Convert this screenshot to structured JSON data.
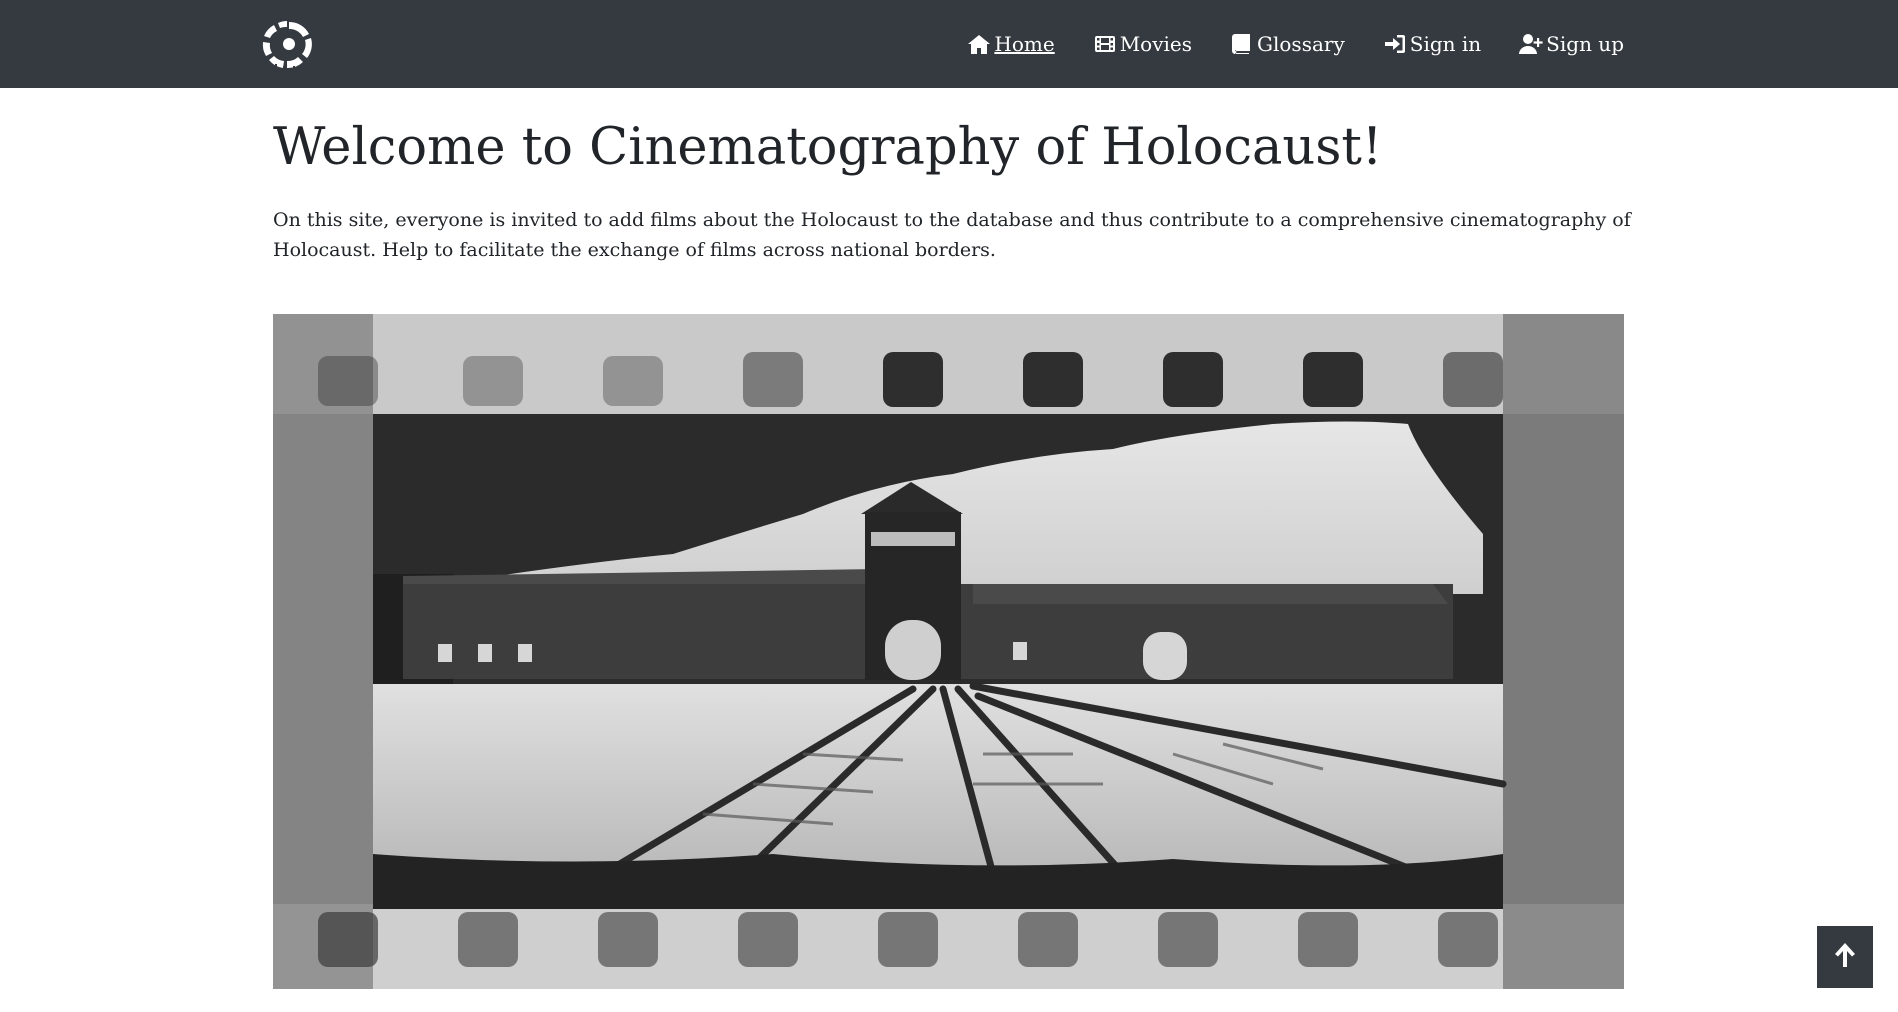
{
  "nav": {
    "logo_icon": "film-reel-logo-icon",
    "items": [
      {
        "label": "Home",
        "icon": "home-icon",
        "active": true
      },
      {
        "label": "Movies",
        "icon": "film-icon",
        "active": false
      },
      {
        "label": "Glossary",
        "icon": "book-icon",
        "active": false
      },
      {
        "label": "Sign in",
        "icon": "sign-in-icon",
        "active": false
      },
      {
        "label": "Sign up",
        "icon": "user-plus-icon",
        "active": false
      }
    ]
  },
  "main": {
    "title": "Welcome to Cinematography of Holocaust!",
    "intro": "On this site, everyone is invited to add films about the Holocaust to the database and thus contribute to a comprehensive cinematography of Holocaust. Help to facilitate the exchange of films across national borders.",
    "hero_icon": "auschwitz-gate-film-strip-image"
  },
  "back_to_top": {
    "icon": "arrow-up-icon"
  },
  "colors": {
    "navbar_bg": "#343a40",
    "nav_text": "#ffffff",
    "body_text": "#212529",
    "page_bg": "#ffffff"
  }
}
